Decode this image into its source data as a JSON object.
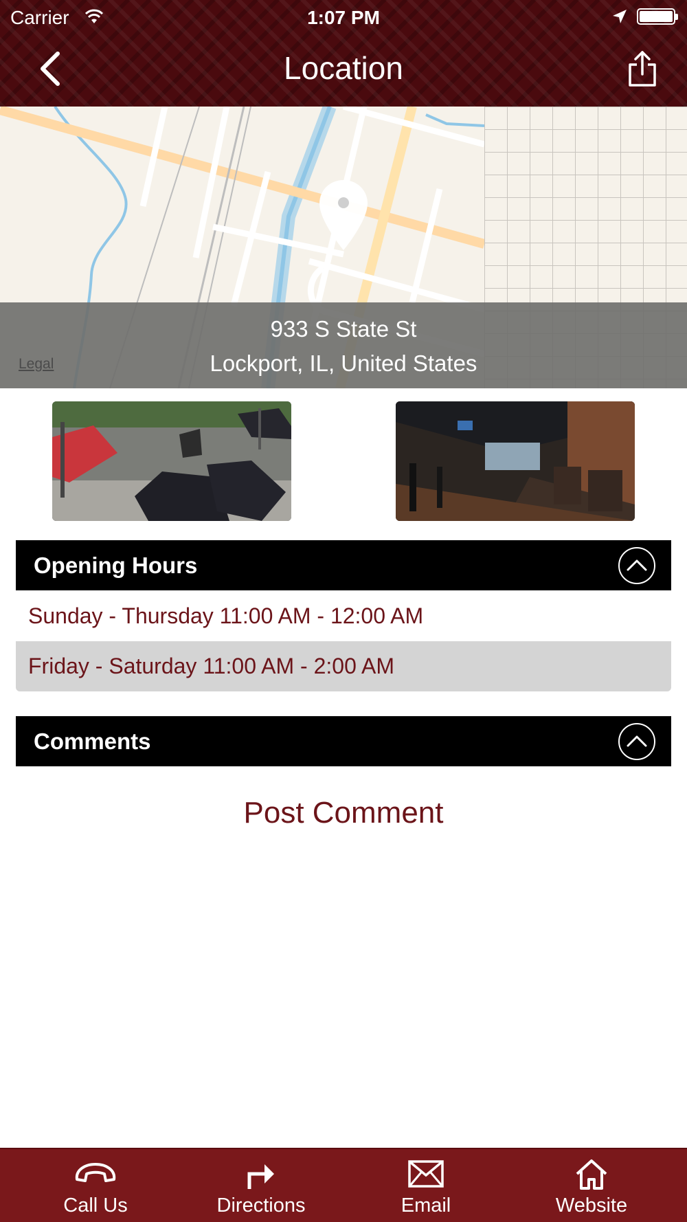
{
  "status_bar": {
    "carrier": "Carrier",
    "time": "1:07 PM"
  },
  "nav": {
    "title": "Location",
    "back_icon": "chevron-left-icon",
    "share_icon": "share-icon"
  },
  "map": {
    "address_line1": "933 S State St",
    "address_line2": "Lockport, IL, United States",
    "legal": "Legal"
  },
  "photos": [
    "patio-photo",
    "interior-photo"
  ],
  "opening_hours": {
    "title": "Opening Hours",
    "rows": [
      "Sunday - Thursday 11:00 AM - 12:00 AM",
      "Friday - Saturday 11:00 AM - 2:00 AM"
    ]
  },
  "comments": {
    "title": "Comments",
    "post_label": "Post Comment"
  },
  "tabbar": {
    "items": [
      {
        "label": "Call Us",
        "icon": "phone-icon"
      },
      {
        "label": "Directions",
        "icon": "directions-icon"
      },
      {
        "label": "Email",
        "icon": "email-icon"
      },
      {
        "label": "Website",
        "icon": "home-icon"
      }
    ]
  },
  "colors": {
    "header_bg": "#4a0a0e",
    "tabbar_bg": "#7a181b",
    "accent_text": "#6b1419"
  }
}
